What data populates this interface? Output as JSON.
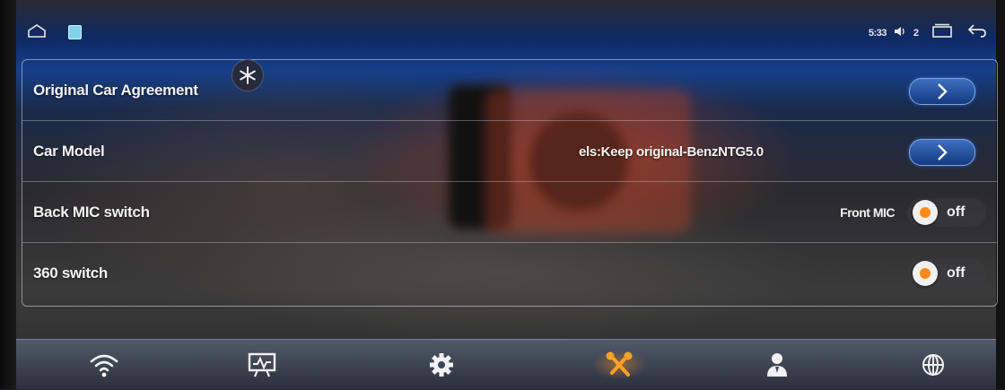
{
  "statusbar": {
    "clock": "5:33",
    "volume_level": "2",
    "icons": [
      "home-icon",
      "app-icon",
      "volume-icon",
      "recent-apps-icon",
      "back-icon"
    ]
  },
  "settings": {
    "rows": [
      {
        "label": "Original Car Agreement",
        "control": "arrow"
      },
      {
        "label": "Car Model",
        "value": "els:Keep original-BenzNTG5.0",
        "control": "arrow"
      },
      {
        "label": "Back MIC switch",
        "prefix": "Front MIC",
        "state": "off",
        "control": "toggle"
      },
      {
        "label": "360 switch",
        "state": "off",
        "control": "toggle"
      }
    ]
  },
  "navbar": {
    "items": [
      {
        "icon": "wifi-icon",
        "active": false
      },
      {
        "icon": "display-icon",
        "active": false
      },
      {
        "icon": "gear-icon",
        "active": false
      },
      {
        "icon": "tools-icon",
        "active": true
      },
      {
        "icon": "user-icon",
        "active": false
      },
      {
        "icon": "globe-icon",
        "active": false
      }
    ]
  },
  "colors": {
    "accent": "#ff8a1a",
    "button_blue": "#1f4a96",
    "text": "#f2f2f2"
  }
}
